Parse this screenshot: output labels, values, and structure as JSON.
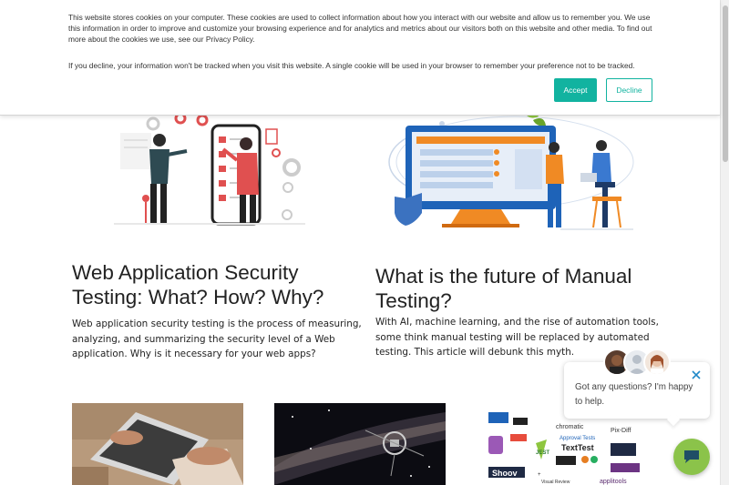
{
  "cookie_banner": {
    "paragraph_1": "This website stores cookies on your computer. These cookies are used to collect information about how you interact with our website and allow us to remember you. We use this information in order to improve and customize your browsing experience and for analytics and metrics about our visitors both on this website and other media. To find out more about the cookies we use, see our Privacy Policy.",
    "paragraph_2": "If you decline, your information won't be tracked when you visit this website. A single cookie will be used in your browser to remember your preference not to be tracked.",
    "accept_label": "Accept",
    "decline_label": "Decline",
    "accent_color": "#12b3a0"
  },
  "articles": [
    {
      "title": "Web Application Security Testing: What? How? Why?",
      "description": "Web application security testing is the process of measuring, analyzing, and summarizing the security level of a Web application. Why is it necessary for your web apps?"
    },
    {
      "title": "What is the future of Manual Testing?",
      "description": "With AI, machine learning, and the rise of automation tools, some think manual testing will be replaced by automated testing. This article will debunk this myth."
    }
  ],
  "tool_logos": [
    "chromatic",
    "Pix-Diff",
    "Approval Tests",
    "TextTest",
    "JEST",
    "Shoov",
    "applitools",
    "Visual Review"
  ],
  "chat": {
    "message": "Got any questions? I'm happy to help.",
    "launcher_color": "#8bc34a"
  }
}
